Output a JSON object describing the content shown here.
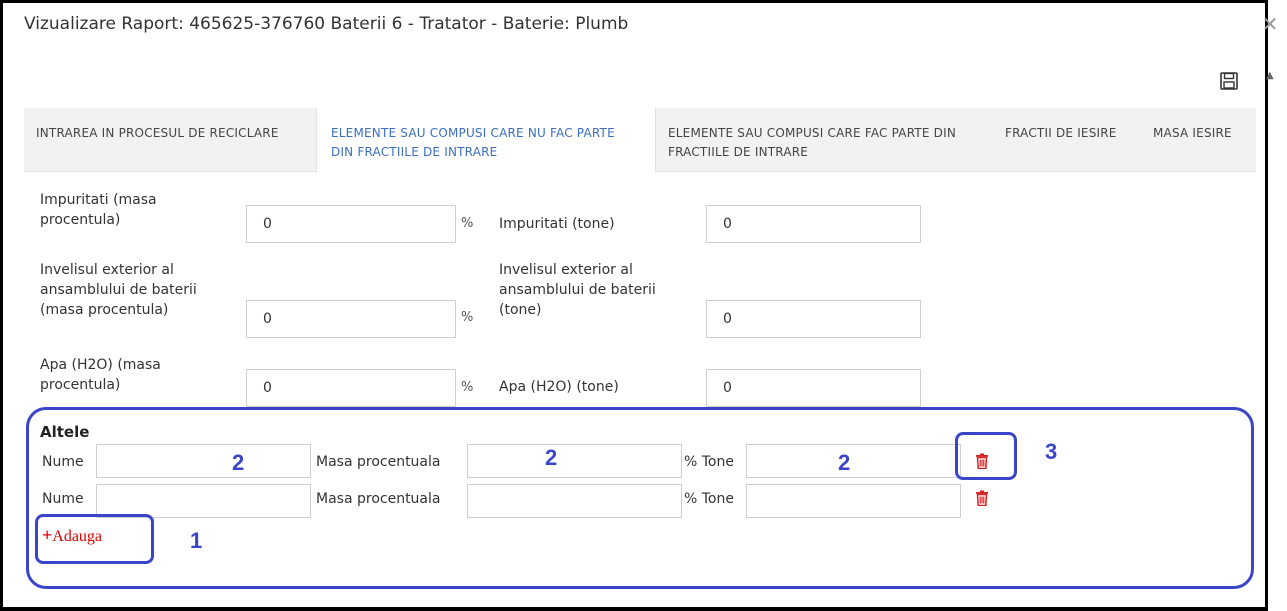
{
  "dialog": {
    "title": "Vizualizare Raport: 465625-376760 Baterii 6 - Tratator - Baterie: Plumb",
    "close_icon": "close-icon",
    "save_icon": "save-icon"
  },
  "tabs": [
    {
      "label": "INTRAREA IN PROCESUL DE RECICLARE",
      "active": false
    },
    {
      "label": "ELEMENTE SAU COMPUSI CARE NU FAC PARTE DIN FRACTIILE DE INTRARE",
      "active": true
    },
    {
      "label": "ELEMENTE SAU COMPUSI CARE FAC PARTE DIN FRACTIILE DE INTRARE",
      "active": false
    },
    {
      "label": "FRACTII DE IESIRE",
      "active": false
    },
    {
      "label": "MASA IESIRE",
      "active": false
    }
  ],
  "form": {
    "rows": [
      {
        "left_label": "Impuritati (masa procentula)",
        "left_value": "0",
        "unit": "%",
        "right_label": "Impuritati (tone)",
        "right_value": "0"
      },
      {
        "left_label": "Invelisul exterior al ansamblului de baterii (masa procentula)",
        "left_value": "0",
        "unit": "%",
        "right_label": "Invelisul exterior al ansamblului de baterii (tone)",
        "right_value": "0"
      },
      {
        "left_label": "Apa (H2O) (masa procentula)",
        "left_value": "0",
        "unit": "%",
        "right_label": "Apa (H2O) (tone)",
        "right_value": "0"
      }
    ]
  },
  "altele": {
    "title": "Altele",
    "rows": [
      {
        "name_label": "Nume",
        "name_value": "",
        "mass_label": "Masa procentuala",
        "mass_value": "",
        "tone_label": "% Tone",
        "tone_value": ""
      },
      {
        "name_label": "Nume",
        "name_value": "",
        "mass_label": "Masa procentuala",
        "mass_value": "",
        "tone_label": "% Tone",
        "tone_value": ""
      }
    ],
    "add_label": "Adauga",
    "delete_icon": "trash-icon"
  },
  "annotations": {
    "n1": "1",
    "n2": "2",
    "n3": "3",
    "color": "#3b45c8"
  }
}
